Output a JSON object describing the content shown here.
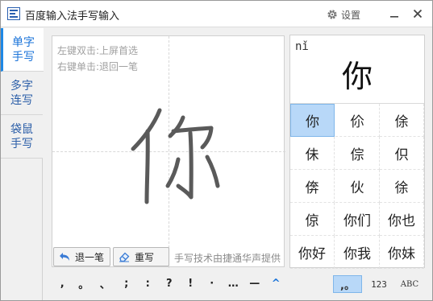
{
  "window": {
    "title": "百度输入法手写输入",
    "settings_label": "设置"
  },
  "tabs": [
    {
      "line1": "单字",
      "line2": "手写",
      "active": true
    },
    {
      "line1": "多字",
      "line2": "连写",
      "active": false
    },
    {
      "line1": "袋鼠",
      "line2": "手写",
      "active": false
    }
  ],
  "pad": {
    "hint_double_click": "左键双击:上屏首选",
    "hint_single_click": "右键单击:退回一笔",
    "undo_label": "退一笔",
    "rewrite_label": "重写",
    "credit": "手写技术由捷通华声提供"
  },
  "candidates": {
    "pinyin": "nǐ",
    "preview": "你",
    "items": [
      "你",
      "伱",
      "俆",
      "佅",
      "倧",
      "伿",
      "倴",
      "伙",
      "徐",
      "倞",
      "你们",
      "你也",
      "你好",
      "你我",
      "你妹"
    ],
    "selected_index": 0
  },
  "punctuation": [
    ",",
    "。",
    "、",
    ";",
    ":",
    "?",
    "!",
    "·",
    "…",
    "—",
    "^"
  ],
  "modes": {
    "symbols": ",。",
    "numbers": "123",
    "letters": "ABC"
  },
  "colors": {
    "accent": "#1e88e5",
    "selected_bg": "#b8d8f8",
    "stroke": "#555555"
  }
}
